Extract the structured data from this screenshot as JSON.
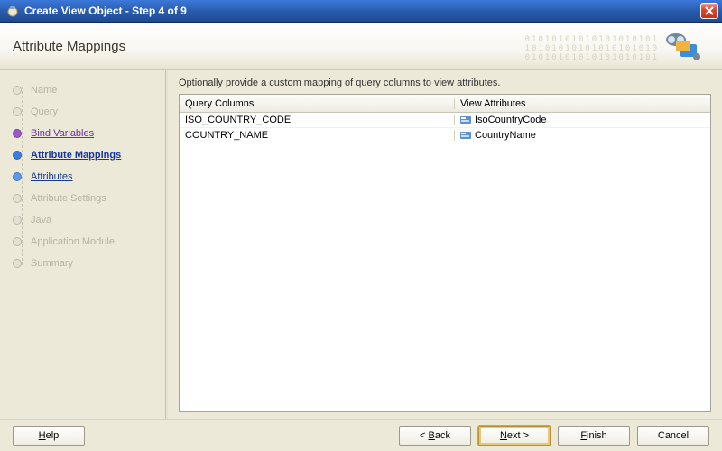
{
  "window": {
    "title": "Create View Object - Step 4 of 9"
  },
  "header": {
    "title": "Attribute Mappings"
  },
  "nav": {
    "items": [
      {
        "label": "Name",
        "state": "disabled"
      },
      {
        "label": "Query",
        "state": "disabled"
      },
      {
        "label": "Bind Variables",
        "state": "visited"
      },
      {
        "label": "Attribute Mappings",
        "state": "current"
      },
      {
        "label": "Attributes",
        "state": "available"
      },
      {
        "label": "Attribute Settings",
        "state": "disabled"
      },
      {
        "label": "Java",
        "state": "disabled"
      },
      {
        "label": "Application Module",
        "state": "disabled"
      },
      {
        "label": "Summary",
        "state": "disabled"
      }
    ]
  },
  "panel": {
    "instruction": "Optionally provide a custom mapping of query columns to view attributes.",
    "columns": {
      "query": "Query Columns",
      "view": "View Attributes"
    },
    "rows": [
      {
        "query": "ISO_COUNTRY_CODE",
        "view": "IsoCountryCode"
      },
      {
        "query": "COUNTRY_NAME",
        "view": "CountryName"
      }
    ]
  },
  "buttons": {
    "help": "Help",
    "back": "< Back",
    "next": "Next >",
    "finish": "Finish",
    "cancel": "Cancel"
  }
}
